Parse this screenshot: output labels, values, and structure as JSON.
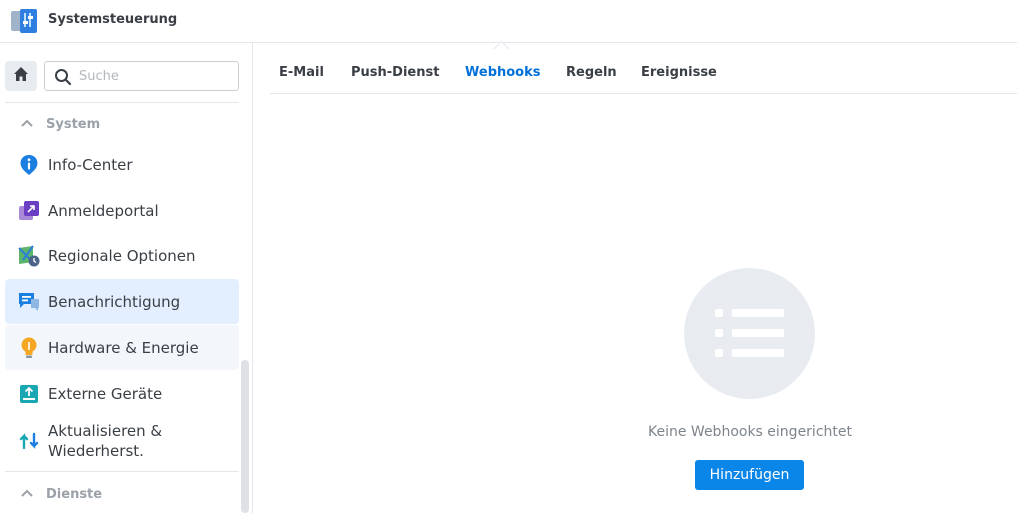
{
  "app": {
    "title": "Systemsteuerung",
    "icon": "control-panel-icon"
  },
  "search": {
    "placeholder": "Suche",
    "value": ""
  },
  "sidebar": {
    "home_icon": "home-icon",
    "sections": [
      {
        "label": "System",
        "items": [
          {
            "label": "Info-Center",
            "icon": "info-icon"
          },
          {
            "label": "Anmeldeportal",
            "icon": "login-portal-icon"
          },
          {
            "label": "Regionale Optionen",
            "icon": "regional-options-icon"
          },
          {
            "label": "Benachrichtigung",
            "icon": "notification-icon",
            "state": "selected"
          },
          {
            "label": "Hardware & Energie",
            "icon": "lightbulb-icon",
            "state": "hover"
          },
          {
            "label": "Externe Geräte",
            "icon": "external-devices-icon"
          },
          {
            "label": "Aktualisieren & Wiederherst.",
            "icon": "update-restore-icon"
          }
        ]
      },
      {
        "label": "Dienste",
        "items": []
      }
    ]
  },
  "tabs": [
    {
      "label": "E-Mail"
    },
    {
      "label": "Push-Dienst"
    },
    {
      "label": "Webhooks",
      "active": true
    },
    {
      "label": "Regeln"
    },
    {
      "label": "Ereignisse"
    }
  ],
  "main": {
    "empty_icon": "list-icon",
    "empty_text": "Keine Webhooks eingerichtet",
    "add_button": "Hinzufügen"
  },
  "colors": {
    "accent": "#0070d9",
    "button": "#0a86e8",
    "selected_item_bg": "#e3efff"
  }
}
